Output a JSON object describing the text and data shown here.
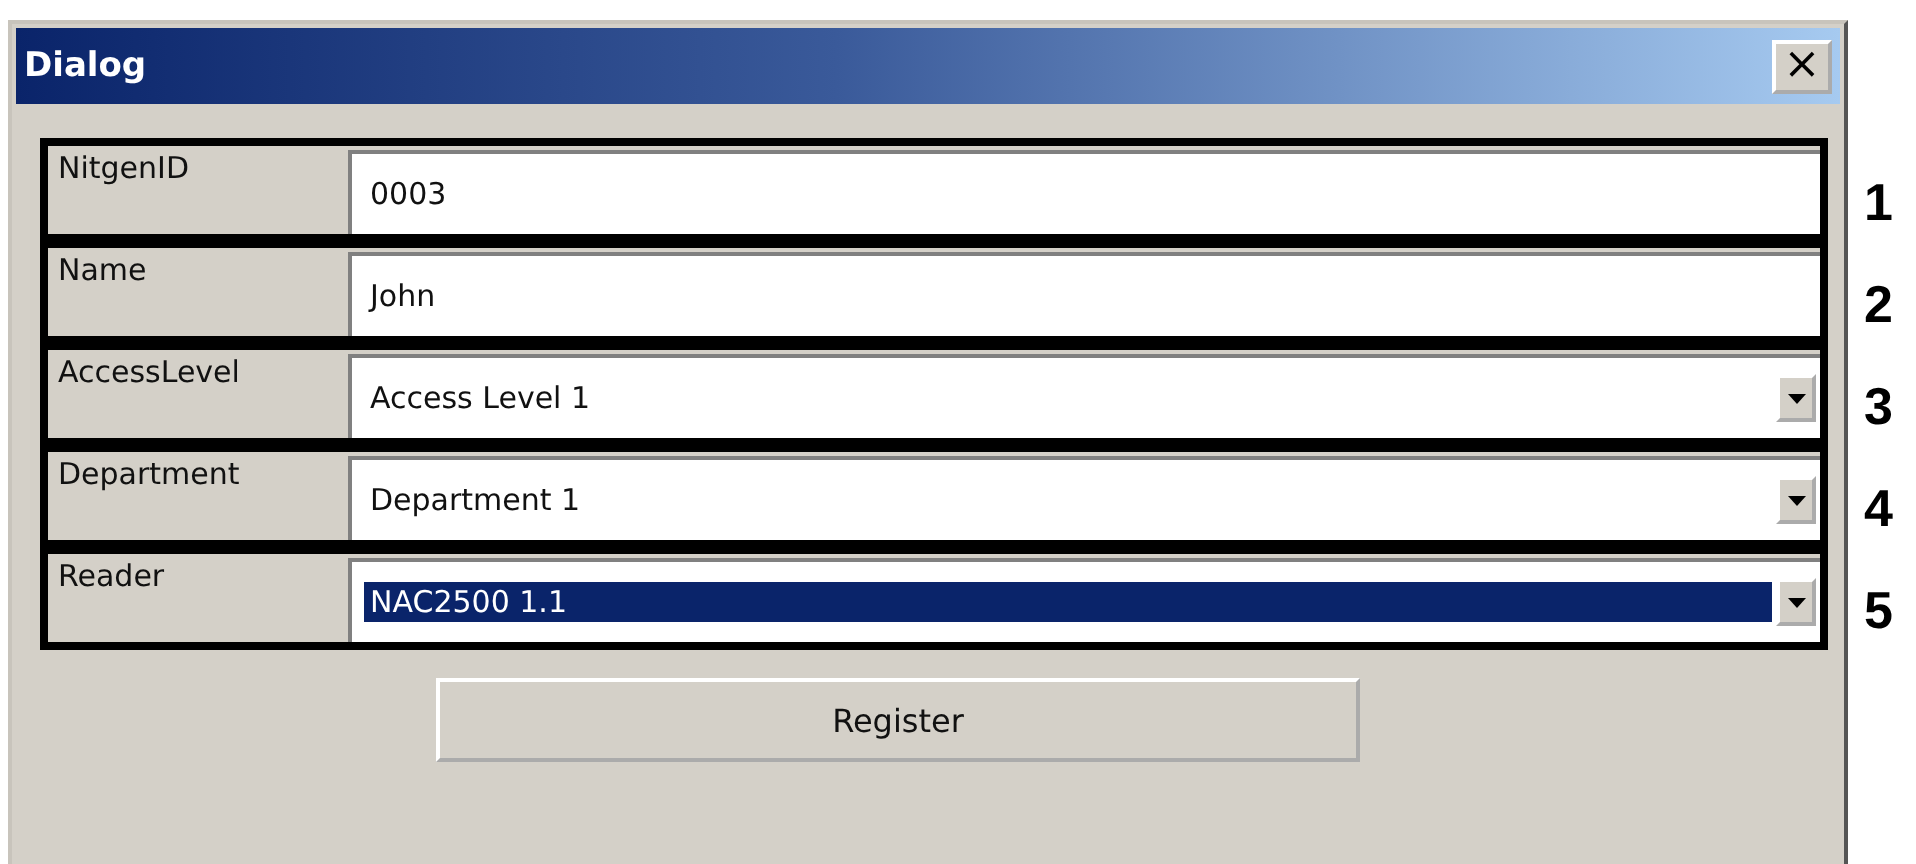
{
  "window": {
    "title": "Dialog",
    "close": "×"
  },
  "rows": [
    {
      "label": "NitgenID",
      "kind": "text",
      "value": "0003",
      "callout": "1"
    },
    {
      "label": "Name",
      "kind": "text",
      "value": "John",
      "callout": "2"
    },
    {
      "label": "AccessLevel",
      "kind": "combo",
      "value": "Access Level 1",
      "selected": false,
      "callout": "3"
    },
    {
      "label": "Department",
      "kind": "combo",
      "value": "Department 1",
      "selected": false,
      "callout": "4"
    },
    {
      "label": "Reader",
      "kind": "combo",
      "value": "NAC2500 1.1",
      "selected": true,
      "callout": "5"
    }
  ],
  "button": "Register"
}
